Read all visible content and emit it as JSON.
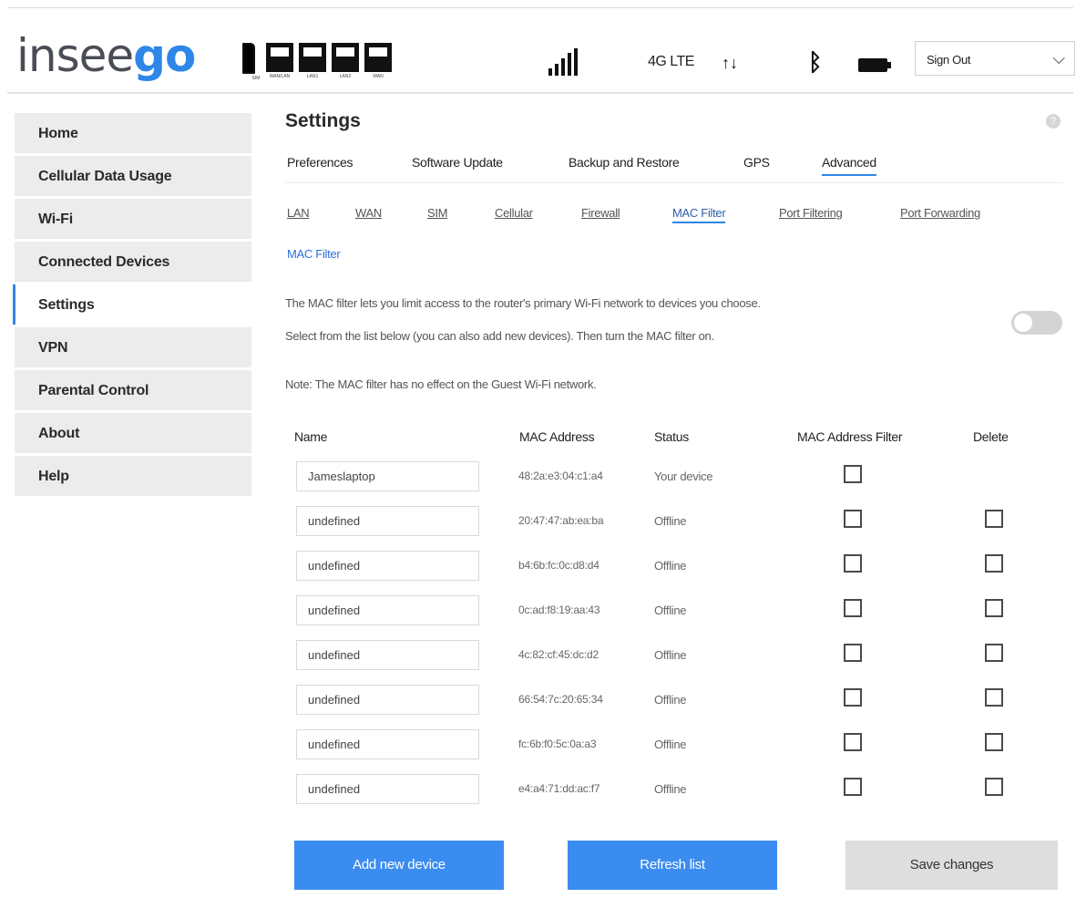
{
  "brand": {
    "part1": "insee",
    "part2": "go"
  },
  "ports": [
    {
      "label": "SIM"
    },
    {
      "label": "WAN/LAN"
    },
    {
      "label": "LAN1"
    },
    {
      "label": "LAN2"
    },
    {
      "label": "WAN"
    }
  ],
  "status_bar": {
    "network": "4G LTE"
  },
  "sign_out": {
    "label": "Sign Out"
  },
  "sidebar": {
    "items": [
      {
        "label": "Home"
      },
      {
        "label": "Cellular Data Usage"
      },
      {
        "label": "Wi-Fi"
      },
      {
        "label": "Connected Devices"
      },
      {
        "label": "Settings"
      },
      {
        "label": "VPN"
      },
      {
        "label": "Parental Control"
      },
      {
        "label": "About"
      },
      {
        "label": "Help"
      }
    ]
  },
  "page": {
    "title": "Settings",
    "help": "?"
  },
  "tabs": [
    {
      "label": "Preferences"
    },
    {
      "label": "Software Update"
    },
    {
      "label": "Backup and Restore"
    },
    {
      "label": "GPS"
    },
    {
      "label": "Advanced"
    }
  ],
  "subtabs": [
    {
      "label": "LAN"
    },
    {
      "label": "WAN"
    },
    {
      "label": "SIM"
    },
    {
      "label": "Cellular"
    },
    {
      "label": "Firewall"
    },
    {
      "label": "MAC Filter"
    },
    {
      "label": "Port Filtering"
    },
    {
      "label": "Port Forwarding"
    }
  ],
  "mac_filter": {
    "section_label": "MAC Filter",
    "desc_line1": "The MAC filter lets you limit access to the router's primary Wi-Fi network to devices you choose.",
    "desc_line2": "Select from the list below (you can also add new devices). Then turn the MAC filter on.",
    "note": "Note: The MAC filter has no effect on the Guest Wi-Fi network.",
    "enabled": false
  },
  "table": {
    "headers": {
      "name": "Name",
      "mac": "MAC Address",
      "status": "Status",
      "filter": "MAC Address Filter",
      "delete": "Delete"
    },
    "rows": [
      {
        "name": "Jameslaptop",
        "mac": "48:2a:e3:04:c1:a4",
        "status": "Your device"
      },
      {
        "name": "undefined",
        "mac": "20:47:47:ab:ea:ba",
        "status": "Offline"
      },
      {
        "name": "undefined",
        "mac": "b4:6b:fc:0c:d8:d4",
        "status": "Offline"
      },
      {
        "name": "undefined",
        "mac": "0c:ad:f8:19:aa:43",
        "status": "Offline"
      },
      {
        "name": "undefined",
        "mac": "4c:82:cf:45:dc:d2",
        "status": "Offline"
      },
      {
        "name": "undefined",
        "mac": "66:54:7c:20:65:34",
        "status": "Offline"
      },
      {
        "name": "undefined",
        "mac": "fc:6b:f0:5c:0a:a3",
        "status": "Offline"
      },
      {
        "name": "undefined",
        "mac": "e4:a4:71:dd:ac:f7",
        "status": "Offline"
      }
    ]
  },
  "buttons": {
    "add": "Add new device",
    "refresh": "Refresh list",
    "save": "Save changes"
  },
  "colors": {
    "accent": "#2e86e8",
    "button_blue": "#3b8cf0",
    "button_disabled": "#dedede"
  }
}
